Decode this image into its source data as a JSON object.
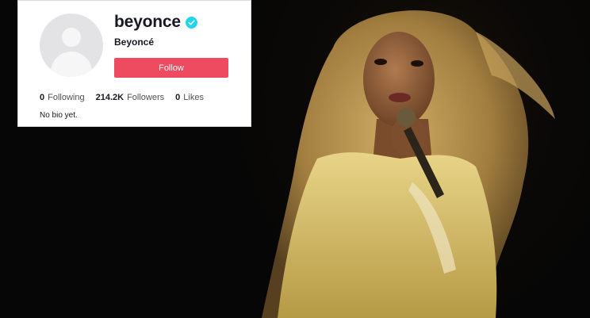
{
  "profile": {
    "username": "beyonce",
    "nickname": "Beyoncé",
    "verified": true,
    "follow_label": "Follow",
    "stats": [
      {
        "value": "0",
        "label": "Following"
      },
      {
        "value": "214.2K",
        "label": "Followers"
      },
      {
        "value": "0",
        "label": "Likes"
      }
    ],
    "bio": "No bio yet."
  },
  "colors": {
    "follow_button": "#ee4a60",
    "verified_badge": "#20d5ec",
    "text": "#161823"
  },
  "icons": {
    "verified": "verified-check-icon",
    "avatar": "default-avatar-icon"
  }
}
